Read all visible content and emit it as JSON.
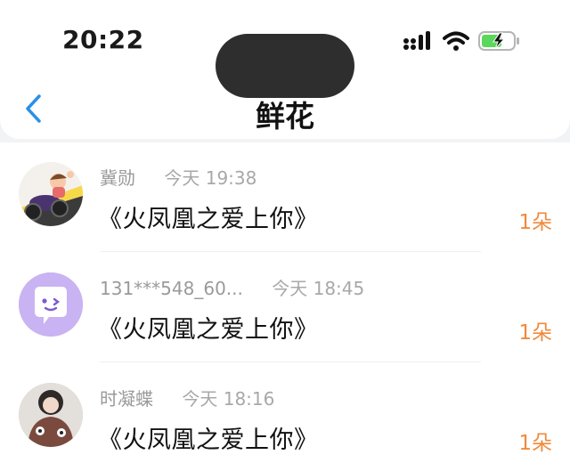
{
  "status_bar": {
    "time": "20:22",
    "icons": [
      "signal-icon",
      "wifi-icon",
      "battery-charging-icon"
    ]
  },
  "nav": {
    "back_icon": "chevron-left-icon",
    "title": "鲜花"
  },
  "colors": {
    "accent_blue": "#2b90e8",
    "count_orange": "#f08a3c",
    "meta_gray": "#9a9a9a",
    "battery_green": "#5bd85b"
  },
  "gifts": [
    {
      "name": "冀勋",
      "time": "今天 19:38",
      "item": "《火凤凰之爱上你》",
      "count": "1朵",
      "avatar": "cartoon-avatar"
    },
    {
      "name": "131***548_60...",
      "time": "今天 18:45",
      "item": "《火凤凰之爱上你》",
      "count": "1朵",
      "avatar": "chat-bubble-avatar"
    },
    {
      "name": "时凝蝶",
      "time": "今天 18:16",
      "item": "《火凤凰之爱上你》",
      "count": "1朵",
      "avatar": "photo-avatar"
    }
  ]
}
